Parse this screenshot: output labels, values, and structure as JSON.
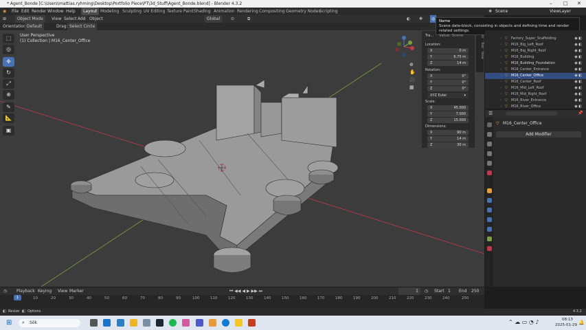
{
  "window": {
    "title": "* Agent_Bonde [C:\\Users\\mattias.ryhming\\Desktop\\Portfolio Piece\\PT\\3d_Stuff\\Agent_Bonde.blend] - Blender 4.3.2"
  },
  "menu": [
    "File",
    "Edit",
    "Render",
    "Window",
    "Help"
  ],
  "workspaces": [
    "Layout",
    "Modeling",
    "Sculpting",
    "UV Editing",
    "Texture Paint",
    "Shading",
    "Animation",
    "Rendering",
    "Compositing",
    "Geometry Nodes",
    "Scripting"
  ],
  "active_workspace": "Layout",
  "scene": {
    "name": "Scene",
    "view_layer": "ViewLayer"
  },
  "header": {
    "mode": "Object Mode",
    "view": "View",
    "select": "Select",
    "add": "Add",
    "object": "Object",
    "transform": "Global"
  },
  "header3": {
    "orientation_label": "Orientation:",
    "orientation": "Default",
    "drag_label": "Drag:",
    "drag": "Select Circle"
  },
  "viewport": {
    "view": "User Perspective",
    "collection": "(1) Collection | M16_Center_Office"
  },
  "tooltip": {
    "title": "Name",
    "desc": "Scene data-block, consisting in objects and defining time and render related settings.",
    "value": "Value: Scene"
  },
  "npanel": {
    "section": "Tra...",
    "location_label": "Location:",
    "location": [
      [
        "X",
        "0 m"
      ],
      [
        "Y",
        "6.75 m"
      ],
      [
        "Z",
        "14 m"
      ]
    ],
    "rotation_label": "Rotation:",
    "rotation": [
      [
        "X",
        "0°"
      ],
      [
        "Y",
        "0°"
      ],
      [
        "Z",
        "0°"
      ]
    ],
    "rotation_mode": "XYZ Euler",
    "scale_label": "Scale:",
    "scale": [
      [
        "X",
        "45.000"
      ],
      [
        "Y",
        "7.000"
      ],
      [
        "Z",
        "15.000"
      ]
    ],
    "dimensions_label": "Dimensions:",
    "dimensions": [
      [
        "X",
        "90 m"
      ],
      [
        "Y",
        "14 m"
      ],
      [
        "Z",
        "30 m"
      ]
    ],
    "tabs": [
      "Item",
      "Tool",
      "View"
    ]
  },
  "outliner": {
    "items": [
      "Factory_Super_Scaffolding",
      "M16_Big_Left_Roof",
      "M16_Big_Right_Roof",
      "M16_Building",
      "M16_Building_Foundation",
      "M16_Center_Entrance",
      "M16_Center_Office",
      "M16_Center_Roof",
      "M16_Mid_Left_Roof",
      "M16_Mid_Right_Roof",
      "M16_River_Entrance",
      "M16_River_Office"
    ],
    "selected": "M16_Center_Office"
  },
  "properties": {
    "object": "M16_Center_Office",
    "add_modifier": "Add Modifier"
  },
  "timeline": {
    "menu": [
      "Playback",
      "Keying",
      "View",
      "Marker"
    ],
    "current_frame": "1",
    "start_label": "Start",
    "start": "1",
    "end_label": "End",
    "end": "250",
    "ticks": [
      "1",
      "10",
      "20",
      "30",
      "40",
      "50",
      "60",
      "70",
      "80",
      "90",
      "100",
      "110",
      "120",
      "130",
      "140",
      "150",
      "160",
      "170",
      "180",
      "190",
      "200",
      "210",
      "220",
      "230",
      "240",
      "250"
    ],
    "current_marker": "1"
  },
  "status": {
    "left": "Resize",
    "options": "Options",
    "version": "4.3.2"
  },
  "taskbar": {
    "search": "Sök",
    "time": "08:13",
    "date": "2025-01-29"
  },
  "colors": {
    "accent": "#4772b3",
    "selected_row": "#334d80",
    "x_axis": "#c0394b",
    "y_axis": "#7aa043"
  }
}
